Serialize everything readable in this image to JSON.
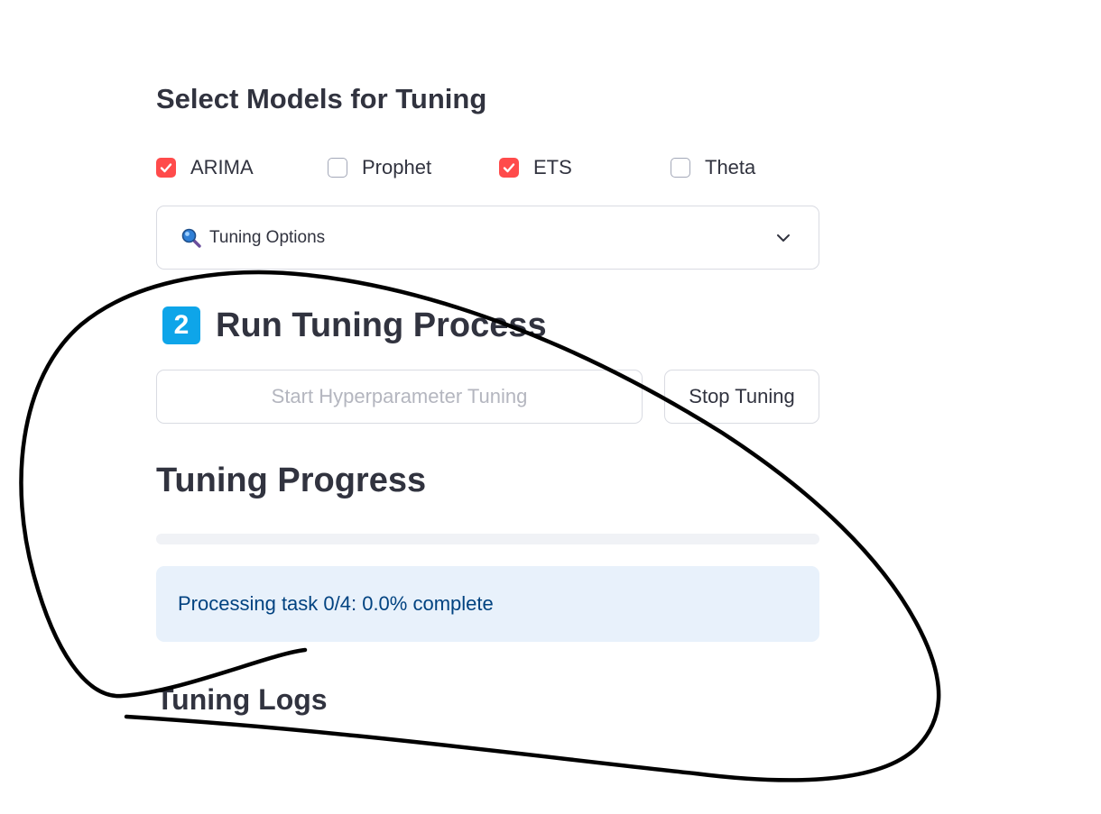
{
  "select_models": {
    "heading": "Select Models for Tuning",
    "models": [
      {
        "label": "ARIMA",
        "checked": true
      },
      {
        "label": "Prophet",
        "checked": false
      },
      {
        "label": "ETS",
        "checked": true
      },
      {
        "label": "Theta",
        "checked": false
      }
    ]
  },
  "tuning_options": {
    "icon": "magnifying-glass-icon",
    "label": "Tuning Options"
  },
  "run_section": {
    "badge": "2",
    "title": "Run Tuning Process",
    "start_button": "Start Hyperparameter Tuning",
    "stop_button": "Stop Tuning"
  },
  "progress": {
    "heading": "Tuning Progress",
    "fraction": 0.0,
    "status_text": "Processing task 0/4: 0.0% complete"
  },
  "logs": {
    "heading": "Tuning Logs"
  },
  "colors": {
    "accent": "#ff4b4b",
    "info_bg": "#e8f1fb",
    "info_text": "#004280",
    "badge": "#0ea5e9"
  }
}
